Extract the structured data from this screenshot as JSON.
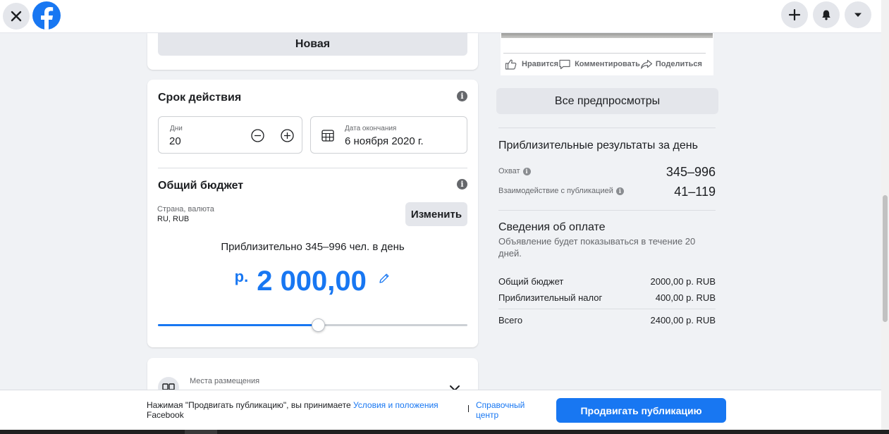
{
  "topbar": {
    "close_icon": "close-icon",
    "logo": "facebook-logo",
    "actions": [
      {
        "icon": "plus-icon"
      },
      {
        "icon": "bell-icon"
      },
      {
        "icon": "caret-down-icon"
      }
    ]
  },
  "left": {
    "new_button": "Новая",
    "duration": {
      "title": "Срок действия",
      "days_label": "Дни",
      "days_value": "20",
      "end_date_label": "Дата окончания",
      "end_date_value": "6 ноября 2020 г."
    },
    "budget": {
      "title": "Общий бюджет",
      "country_label": "Страна, валюта",
      "country_value": "RU, RUB",
      "change_button": "Изменить",
      "estimate_text": "Приблизительно 345–996 чел. в день",
      "currency_symbol": "р.",
      "amount": "2 000,00",
      "slider_fraction": 0.52
    },
    "placements": {
      "label": "Места размещения"
    }
  },
  "right": {
    "post_actions": {
      "like": "Нравится",
      "comment": "Комментировать",
      "share": "Поделиться"
    },
    "all_previews_button": "Все предпросмотры",
    "daily_results": {
      "title": "Приблизительные результаты за день",
      "reach_label": "Охват",
      "reach_value": "345–996",
      "engagement_label": "Взаимодействие с публикацией",
      "engagement_value": "41–119"
    },
    "payment": {
      "title": "Сведения об оплате",
      "description": "Объявление будет показываться в течение 20 дней.",
      "rows": [
        {
          "label": "Общий бюджет",
          "value": "2000,00 р. RUB"
        },
        {
          "label": "Приблизительный налог",
          "value": "400,00 р. RUB"
        }
      ],
      "total_label": "Всего",
      "total_value": "2400,00 р. RUB"
    }
  },
  "footer": {
    "terms_prefix": "Нажимая \"Продвигать публикацию\", вы принимаете ",
    "terms_link": "Условия и положения",
    "terms_suffix": "Facebook",
    "help_link": "Справочный центр",
    "promote_button": "Продвигать публикацию"
  },
  "colors": {
    "accent": "#1877f2",
    "page_bg": "#f0f2f5",
    "button_gray": "#e4e6eb"
  }
}
